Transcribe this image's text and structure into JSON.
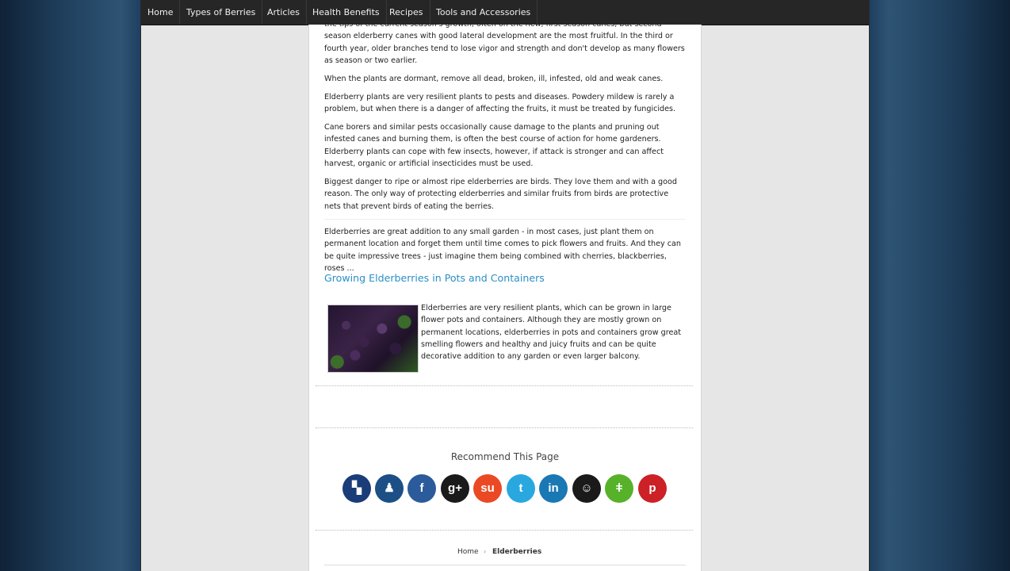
{
  "nav": {
    "items": [
      "Home",
      "Types of Berries",
      "Articles",
      "Health Benefits",
      "Recipes",
      "Tools and Accessories"
    ]
  },
  "article": {
    "paragraphs": [
      "the tips of the current season's growth, often on the new, first season canes, but second season elderberry canes with good lateral development are the most fruitful. In the third or fourth year, older branches tend to lose vigor and strength and don't develop as many flowers as season or two earlier.",
      "When the plants are dormant, remove all dead, broken, ill, infested, old and weak canes.",
      "Elderberry plants are very resilient plants to pests and diseases. Powdery mildew is rarely a problem, but when there is a danger of affecting the fruits, it must be treated by fungicides.",
      "Cane borers and similar pests occasionally cause damage to the plants and pruning out infested canes and burning them, is often the best course of action for home gardeners. Elderberry plants can cope with few insects, however, if attack is stronger and can affect harvest, organic or artificial insecticides must be used.",
      "Biggest danger to ripe or almost ripe elderberries are birds. They love them and with a good reason. The only way of protecting elderberries and similar fruits from birds are protective nets that prevent birds of eating the berries."
    ],
    "summary": " Elderberries are great addition to any small garden - in most cases, just plant them on permanent location and forget them until time comes to pick flowers and fruits. And they can be quite impressive trees - just imagine them being combined with cherries, blackberries, roses ...",
    "section_heading": "Growing Elderberries in Pots and Containers",
    "section_text": "Elderberries are very resilient plants, which can be grown in large flower pots and containers. Although they are mostly grown on permanent locations, elderberries in pots and containers grow great smelling flowers and healthy and juicy fruits and can be quite decorative addition to any garden or even larger balcony."
  },
  "recommend": {
    "title": "Recommend This Page",
    "buttons": [
      {
        "icon": "delicious-icon",
        "glyph": "▚",
        "color": "#1a3c78"
      },
      {
        "icon": "digg-icon",
        "glyph": "♟",
        "color": "#1c4f86"
      },
      {
        "icon": "facebook-icon",
        "glyph": "f",
        "color": "#2b5b9b"
      },
      {
        "icon": "google-plus-icon",
        "glyph": "g+",
        "color": "#1a1a1a"
      },
      {
        "icon": "stumbleupon-icon",
        "glyph": "su",
        "color": "#eb4924"
      },
      {
        "icon": "twitter-icon",
        "glyph": "t",
        "color": "#29a8e0"
      },
      {
        "icon": "linkedin-icon",
        "glyph": "in",
        "color": "#1a78b4"
      },
      {
        "icon": "reddit-icon",
        "glyph": "☺",
        "color": "#1a1a1a"
      },
      {
        "icon": "evernote-icon",
        "glyph": "ǂ",
        "color": "#57b22a"
      },
      {
        "icon": "pinterest-icon",
        "glyph": "p",
        "color": "#cc2127"
      }
    ]
  },
  "breadcrumb": {
    "home": "Home",
    "current": "Elderberries"
  }
}
